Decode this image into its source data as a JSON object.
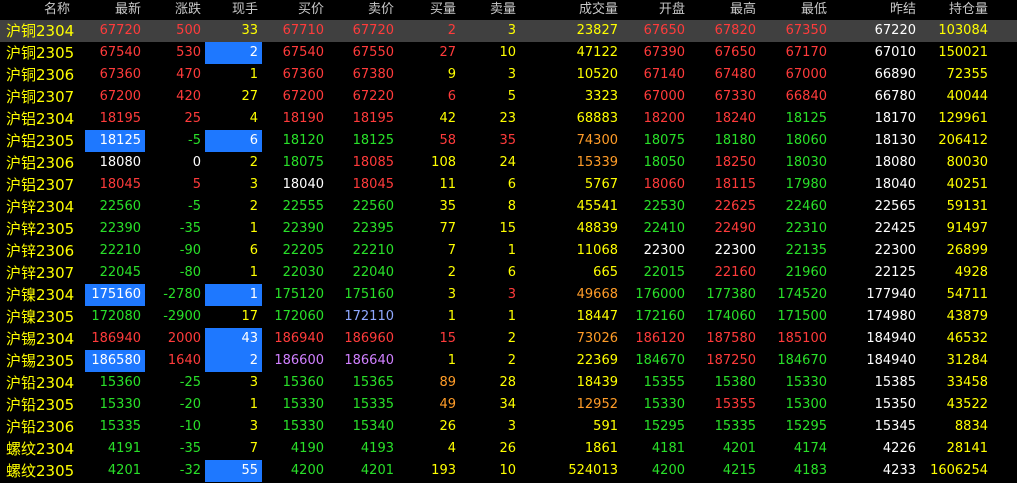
{
  "headers": [
    "名称",
    "最新",
    "涨跌",
    "现手",
    "买价",
    "卖价",
    "买量",
    "卖量",
    "成交量",
    "开盘",
    "最高",
    "最低",
    "昨结",
    "持仓量"
  ],
  "rows": [
    {
      "name": "沪铜2304",
      "c": [
        "67720",
        "500",
        "33",
        "67710",
        "67720",
        "2",
        "3",
        "23827",
        "67650",
        "67820",
        "67350",
        "67220",
        "103084"
      ]
    },
    {
      "name": "沪铜2305",
      "c": [
        "67540",
        "530",
        "2",
        "67540",
        "67550",
        "27",
        "10",
        "47122",
        "67390",
        "67650",
        "67170",
        "67010",
        "150021"
      ]
    },
    {
      "name": "沪铜2306",
      "c": [
        "67360",
        "470",
        "1",
        "67360",
        "67380",
        "9",
        "3",
        "10520",
        "67140",
        "67480",
        "67000",
        "66890",
        "72355"
      ]
    },
    {
      "name": "沪铜2307",
      "c": [
        "67200",
        "420",
        "27",
        "67200",
        "67220",
        "6",
        "5",
        "3323",
        "67000",
        "67330",
        "66840",
        "66780",
        "40044"
      ]
    },
    {
      "name": "沪铝2304",
      "c": [
        "18195",
        "25",
        "4",
        "18190",
        "18195",
        "42",
        "23",
        "68883",
        "18200",
        "18240",
        "18125",
        "18170",
        "129961"
      ]
    },
    {
      "name": "沪铝2305",
      "c": [
        "18125",
        "-5",
        "6",
        "18120",
        "18125",
        "58",
        "35",
        "74300",
        "18075",
        "18180",
        "18060",
        "18130",
        "206412"
      ]
    },
    {
      "name": "沪铝2306",
      "c": [
        "18080",
        "0",
        "2",
        "18075",
        "18085",
        "108",
        "24",
        "15339",
        "18050",
        "18250",
        "18030",
        "18080",
        "80030"
      ]
    },
    {
      "name": "沪铝2307",
      "c": [
        "18045",
        "5",
        "3",
        "18040",
        "18045",
        "11",
        "6",
        "5767",
        "18060",
        "18115",
        "17980",
        "18040",
        "40251"
      ]
    },
    {
      "name": "沪锌2304",
      "c": [
        "22560",
        "-5",
        "2",
        "22555",
        "22560",
        "35",
        "8",
        "45541",
        "22530",
        "22625",
        "22460",
        "22565",
        "59131"
      ]
    },
    {
      "name": "沪锌2305",
      "c": [
        "22390",
        "-35",
        "1",
        "22390",
        "22395",
        "77",
        "15",
        "48839",
        "22410",
        "22490",
        "22310",
        "22425",
        "91497"
      ]
    },
    {
      "name": "沪锌2306",
      "c": [
        "22210",
        "-90",
        "6",
        "22205",
        "22210",
        "7",
        "1",
        "11068",
        "22300",
        "22300",
        "22135",
        "22300",
        "26899"
      ]
    },
    {
      "name": "沪锌2307",
      "c": [
        "22045",
        "-80",
        "1",
        "22030",
        "22040",
        "2",
        "6",
        "665",
        "22015",
        "22160",
        "21960",
        "22125",
        "4928"
      ]
    },
    {
      "name": "沪镍2304",
      "c": [
        "175160",
        "-2780",
        "1",
        "175120",
        "175160",
        "3",
        "3",
        "49668",
        "176000",
        "177380",
        "174520",
        "177940",
        "54711"
      ]
    },
    {
      "name": "沪镍2305",
      "c": [
        "172080",
        "-2900",
        "17",
        "172060",
        "172110",
        "1",
        "1",
        "18447",
        "172160",
        "174060",
        "171500",
        "174980",
        "43879"
      ]
    },
    {
      "name": "沪锡2304",
      "c": [
        "186940",
        "2000",
        "43",
        "186940",
        "186960",
        "15",
        "2",
        "73026",
        "186120",
        "187580",
        "185100",
        "184940",
        "46532"
      ]
    },
    {
      "name": "沪锡2305",
      "c": [
        "186580",
        "1640",
        "2",
        "186600",
        "186640",
        "1",
        "2",
        "22369",
        "184670",
        "187250",
        "184670",
        "184940",
        "31284"
      ]
    },
    {
      "name": "沪铅2304",
      "c": [
        "15360",
        "-25",
        "3",
        "15360",
        "15365",
        "89",
        "28",
        "18439",
        "15355",
        "15380",
        "15330",
        "15385",
        "33458"
      ]
    },
    {
      "name": "沪铅2305",
      "c": [
        "15330",
        "-20",
        "1",
        "15330",
        "15335",
        "49",
        "34",
        "12952",
        "15330",
        "15355",
        "15300",
        "15350",
        "43522"
      ]
    },
    {
      "name": "沪铅2306",
      "c": [
        "15335",
        "-10",
        "3",
        "15330",
        "15340",
        "26",
        "3",
        "591",
        "15295",
        "15335",
        "15295",
        "15345",
        "8834"
      ]
    },
    {
      "name": "螺纹2304",
      "c": [
        "4191",
        "-35",
        "7",
        "4190",
        "4193",
        "4",
        "26",
        "1861",
        "4181",
        "4201",
        "4174",
        "4226",
        "28141"
      ]
    },
    {
      "name": "螺纹2305",
      "c": [
        "4201",
        "-32",
        "55",
        "4200",
        "4201",
        "193",
        "10",
        "524013",
        "4200",
        "4215",
        "4183",
        "4233",
        "1606254"
      ]
    }
  ],
  "colors": [
    [
      "r",
      "r",
      "y",
      "r",
      "r",
      "r",
      "y",
      "y",
      "r",
      "r",
      "r",
      "w",
      "y"
    ],
    [
      "r",
      "r",
      "w",
      "r",
      "r",
      "r",
      "y",
      "y",
      "r",
      "r",
      "r",
      "w",
      "y"
    ],
    [
      "r",
      "r",
      "y",
      "r",
      "r",
      "y",
      "y",
      "y",
      "r",
      "r",
      "r",
      "w",
      "y"
    ],
    [
      "r",
      "r",
      "y",
      "r",
      "r",
      "r",
      "y",
      "y",
      "r",
      "r",
      "r",
      "w",
      "y"
    ],
    [
      "r",
      "r",
      "y",
      "r",
      "r",
      "y",
      "y",
      "y",
      "r",
      "r",
      "g",
      "w",
      "y"
    ],
    [
      "w",
      "g",
      "w",
      "g",
      "g",
      "r",
      "r",
      "o",
      "g",
      "g",
      "g",
      "w",
      "y"
    ],
    [
      "w",
      "w",
      "y",
      "g",
      "r",
      "y",
      "y",
      "o",
      "g",
      "r",
      "g",
      "w",
      "y"
    ],
    [
      "r",
      "r",
      "y",
      "w",
      "r",
      "y",
      "y",
      "y",
      "r",
      "r",
      "g",
      "w",
      "y"
    ],
    [
      "g",
      "g",
      "y",
      "g",
      "g",
      "y",
      "y",
      "y",
      "g",
      "r",
      "g",
      "w",
      "y"
    ],
    [
      "g",
      "g",
      "y",
      "g",
      "g",
      "y",
      "y",
      "y",
      "g",
      "r",
      "g",
      "w",
      "y"
    ],
    [
      "g",
      "g",
      "y",
      "g",
      "g",
      "y",
      "y",
      "y",
      "w",
      "w",
      "g",
      "w",
      "y"
    ],
    [
      "g",
      "g",
      "y",
      "g",
      "g",
      "y",
      "y",
      "y",
      "g",
      "r",
      "g",
      "w",
      "y"
    ],
    [
      "w",
      "g",
      "w",
      "g",
      "g",
      "y",
      "r",
      "o",
      "g",
      "g",
      "g",
      "w",
      "y"
    ],
    [
      "g",
      "g",
      "y",
      "g",
      "b",
      "y",
      "y",
      "y",
      "g",
      "g",
      "g",
      "w",
      "y"
    ],
    [
      "r",
      "r",
      "w",
      "r",
      "r",
      "r",
      "y",
      "o",
      "r",
      "r",
      "r",
      "w",
      "y"
    ],
    [
      "w",
      "r",
      "w",
      "p",
      "p",
      "y",
      "y",
      "y",
      "g",
      "r",
      "g",
      "w",
      "y"
    ],
    [
      "g",
      "g",
      "y",
      "g",
      "g",
      "o",
      "y",
      "y",
      "g",
      "g",
      "g",
      "w",
      "y"
    ],
    [
      "g",
      "g",
      "y",
      "g",
      "g",
      "o",
      "y",
      "o",
      "g",
      "r",
      "g",
      "w",
      "y"
    ],
    [
      "g",
      "g",
      "y",
      "g",
      "g",
      "y",
      "y",
      "y",
      "g",
      "g",
      "g",
      "w",
      "y"
    ],
    [
      "g",
      "g",
      "y",
      "g",
      "g",
      "y",
      "y",
      "y",
      "g",
      "g",
      "g",
      "w",
      "y"
    ],
    [
      "g",
      "g",
      "w",
      "g",
      "g",
      "y",
      "y",
      "y",
      "g",
      "g",
      "g",
      "w",
      "y"
    ]
  ],
  "highlight": [
    [],
    [
      2
    ],
    [],
    [],
    [],
    [
      0,
      2
    ],
    [],
    [],
    [],
    [],
    [],
    [],
    [
      0,
      2
    ],
    [],
    [
      2
    ],
    [
      0,
      2
    ],
    [],
    [],
    [],
    [],
    [
      2
    ]
  ],
  "selected_row": 0
}
